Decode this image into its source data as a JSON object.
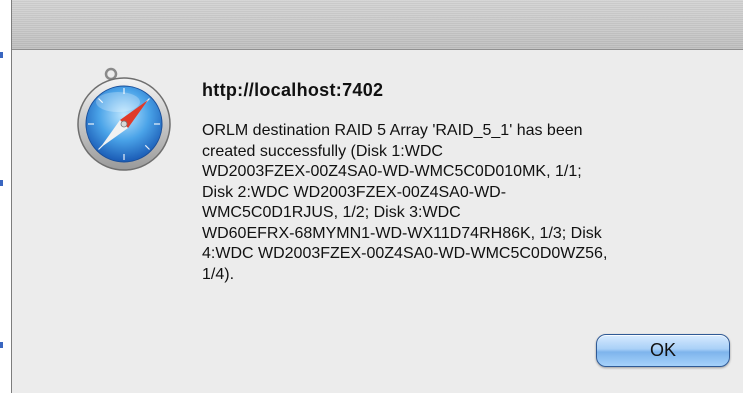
{
  "dialog": {
    "title": "http://localhost:7402",
    "message_lines": [
      "ORLM destination RAID 5 Array 'RAID_5_1' has been",
      "created successfully (Disk 1:WDC",
      "WD2003FZEX-00Z4SA0-WD-WMC5C0D010MK, 1/1;",
      "Disk 2:WDC WD2003FZEX-00Z4SA0-WD-",
      "WMC5C0D1RJUS, 1/2; Disk 3:WDC",
      "WD60EFRX-68MYMN1-WD-WX11D74RH86K, 1/3; Disk",
      "4:WDC WD2003FZEX-00Z4SA0-WD-WMC5C0D0WZ56,",
      "1/4)."
    ],
    "ok_label": "OK",
    "icon": "safari-compass-icon"
  },
  "colors": {
    "dialog_bg": "#ececec",
    "button_blue": "#7eb4ec",
    "compass_blue": "#4aa3e8"
  }
}
